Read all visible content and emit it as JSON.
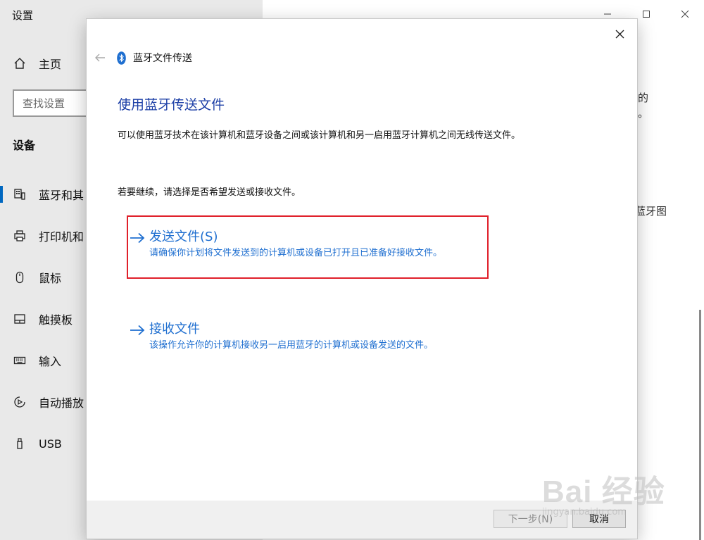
{
  "settings": {
    "title": "设置",
    "home_label": "主页",
    "search_placeholder": "查找设置",
    "section": "设备",
    "nav": [
      {
        "label": "蓝牙和其",
        "icon": "bluetooth-devices-icon"
      },
      {
        "label": "打印机和",
        "icon": "printer-icon"
      },
      {
        "label": "鼠标",
        "icon": "mouse-icon"
      },
      {
        "label": "触摸板",
        "icon": "touchpad-icon"
      },
      {
        "label": "输入",
        "icon": "keyboard-icon"
      },
      {
        "label": "自动播放",
        "icon": "autoplay-icon"
      },
      {
        "label": "USB",
        "icon": "usb-icon"
      }
    ],
    "right_fragment_1": "的",
    "right_fragment_2": "。",
    "right_fragment_3": "蓝牙图"
  },
  "dialog": {
    "title": "蓝牙文件传送",
    "heading": "使用蓝牙传送文件",
    "description": "可以使用蓝牙技术在该计算机和蓝牙设备之间或该计算机和另一启用蓝牙计算机之间无线传送文件。",
    "instruction": "若要继续，请选择是否希望发送或接收文件。",
    "send": {
      "title": "发送文件(S)",
      "subtitle": "请确保你计划将文件发送到的计算机或设备已打开且已准备好接收文件。"
    },
    "receive": {
      "title": "接收文件",
      "subtitle": "该操作允许你的计算机接收另一启用蓝牙的计算机或设备发送的文件。"
    },
    "next_button": "下一步(N)",
    "cancel_button": "取消"
  },
  "watermark": {
    "text": "Bai 经验",
    "sub": "jingyan.baidu.com"
  },
  "colors": {
    "accent": "#1f6fd0",
    "heading": "#1b3ea6",
    "highlight": "#e0202a"
  }
}
